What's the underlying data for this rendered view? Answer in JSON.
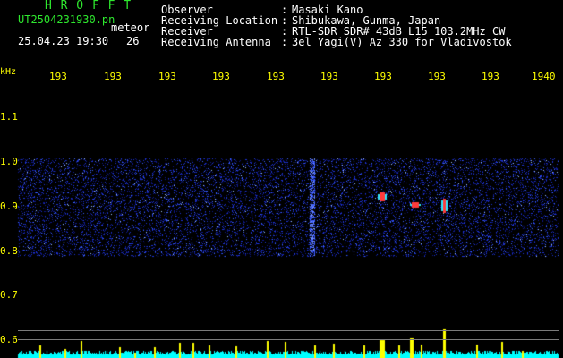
{
  "header": {
    "app_title": "H R O F F T",
    "filename": "UT2504231930.pn",
    "mode": "meteor",
    "datetime": "25.04.23 19:30",
    "count": "26"
  },
  "station": {
    "rows": [
      {
        "label": "Observer",
        "value": "Masaki Kano"
      },
      {
        "label": "Receiving Location",
        "value": "Shibukawa, Gunma, Japan"
      },
      {
        "label": "Receiver",
        "value": "RTL-SDR SDR# 43dB L15 103.2MHz CW"
      },
      {
        "label": "Receiving Antenna",
        "value": "3el Yagi(V) Az 330 for Vladivostok"
      }
    ]
  },
  "axes": {
    "y_unit": "kHz",
    "y_ticks": [
      "1.1",
      "1.0",
      "0.9",
      "0.8",
      "0.7",
      "0.6"
    ],
    "x_ticks": [
      "193",
      "193",
      "193",
      "193",
      "193",
      "193",
      "193",
      "193",
      "193",
      "1940"
    ]
  },
  "colors": {
    "title": "#2ee82e",
    "text": "#ffffff",
    "axis": "#ffff00",
    "signal": "#00ffff",
    "noise": "#1a3aff"
  }
}
